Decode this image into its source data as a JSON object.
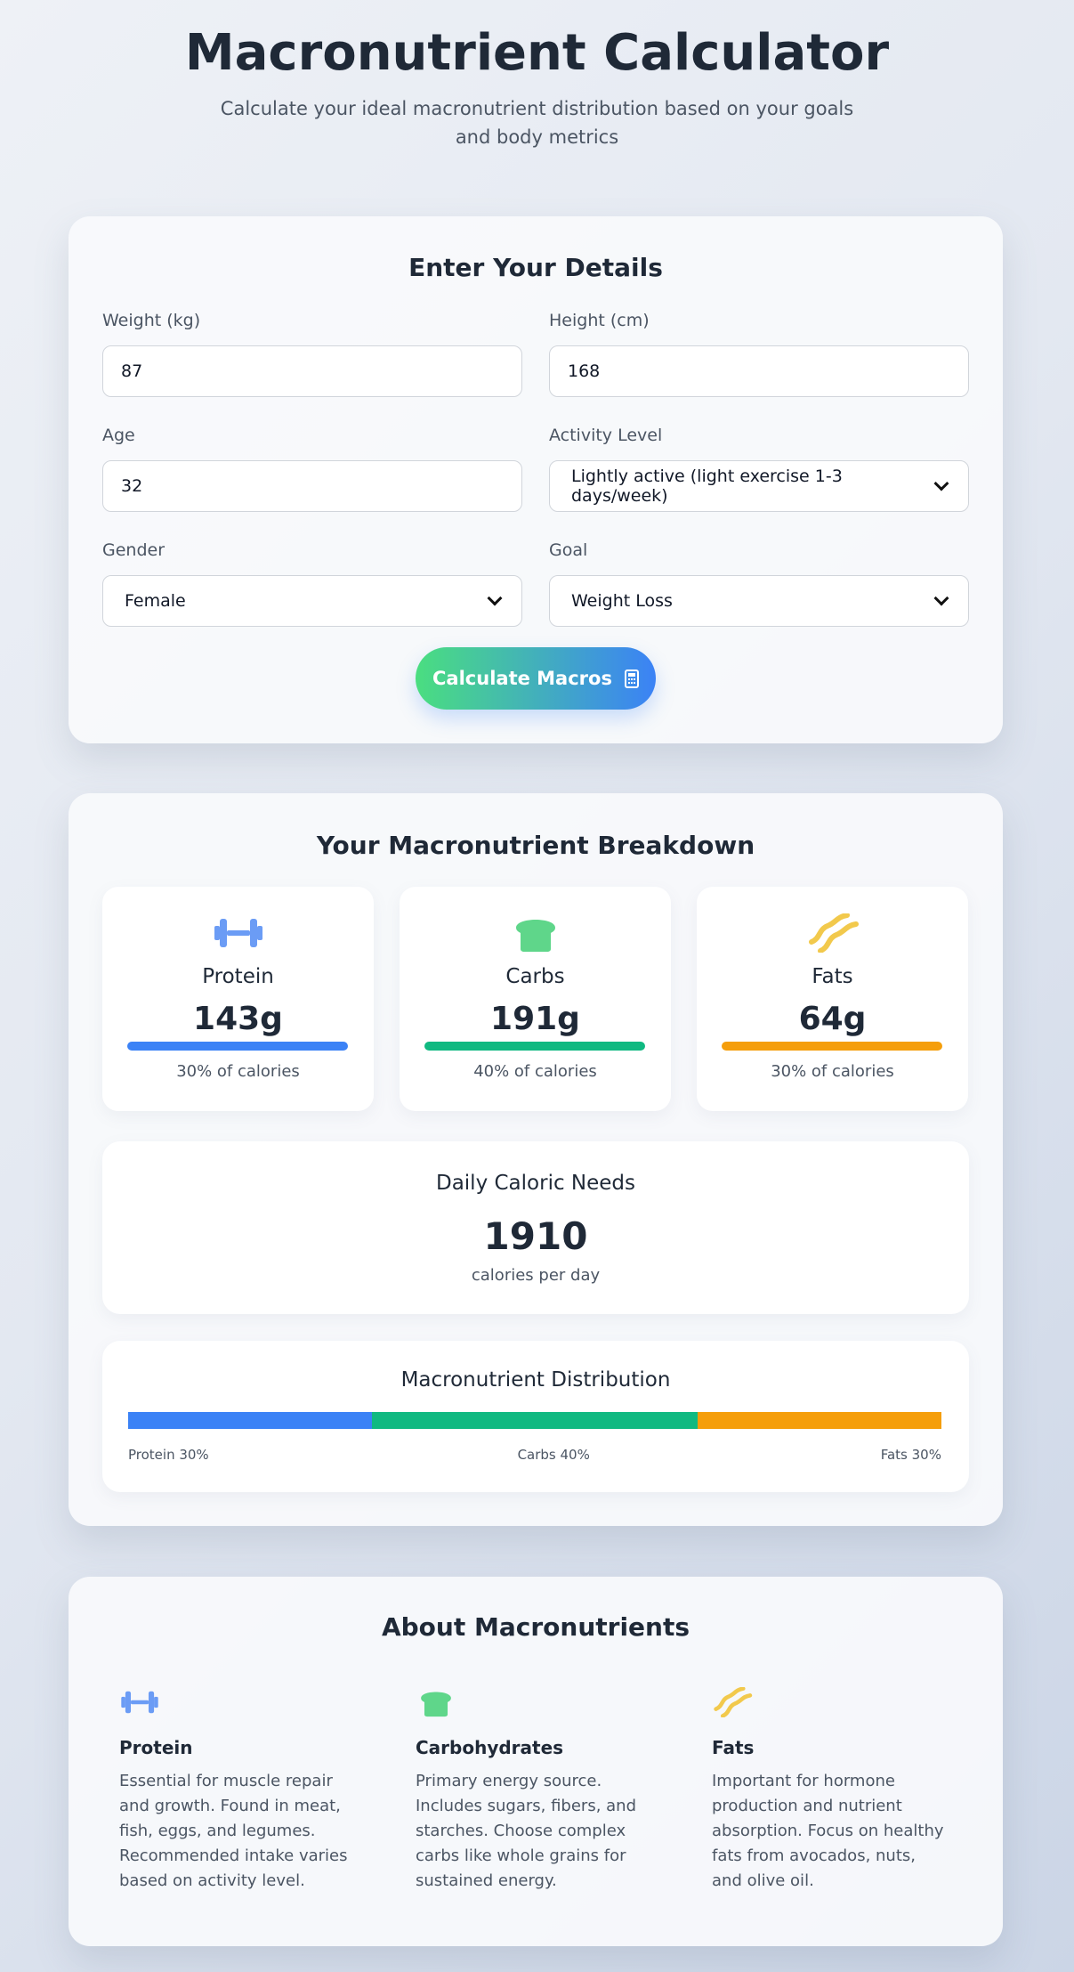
{
  "header": {
    "title": "Macronutrient Calculator",
    "subtitle": "Calculate your ideal macronutrient distribution based on your goals and body metrics"
  },
  "form": {
    "title": "Enter Your Details",
    "weight": {
      "label": "Weight (kg)",
      "value": "87"
    },
    "height": {
      "label": "Height (cm)",
      "value": "168"
    },
    "age": {
      "label": "Age",
      "value": "32"
    },
    "activity": {
      "label": "Activity Level",
      "value": "Lightly active (light exercise 1-3 days/week)"
    },
    "gender": {
      "label": "Gender",
      "value": "Female"
    },
    "goal": {
      "label": "Goal",
      "value": "Weight Loss"
    },
    "calculate_label": "Calculate Macros"
  },
  "results": {
    "title": "Your Macronutrient Breakdown",
    "macros": [
      {
        "name": "Protein",
        "grams": "143g",
        "percent_label": "30% of calories",
        "percent": 30,
        "color": "#3b82f6",
        "icon": "dumbbell-icon"
      },
      {
        "name": "Carbs",
        "grams": "191g",
        "percent_label": "40% of calories",
        "percent": 40,
        "color": "#10b981",
        "icon": "bread-icon"
      },
      {
        "name": "Fats",
        "grams": "64g",
        "percent_label": "30% of calories",
        "percent": 30,
        "color": "#f59e0b",
        "icon": "bacon-icon"
      }
    ],
    "calories": {
      "title": "Daily Caloric Needs",
      "value": "1910",
      "unit": "calories per day"
    },
    "distribution": {
      "title": "Macronutrient Distribution",
      "labels": [
        "Protein 30%",
        "Carbs 40%",
        "Fats 30%"
      ]
    }
  },
  "about": {
    "title": "About Macronutrients",
    "items": [
      {
        "name": "Protein",
        "icon": "dumbbell-icon",
        "description": "Essential for muscle repair and growth. Found in meat, fish, eggs, and legumes. Recommended intake varies based on activity level."
      },
      {
        "name": "Carbohydrates",
        "icon": "bread-icon",
        "description": "Primary energy source. Includes sugars, fibers, and starches. Choose complex carbs like whole grains for sustained energy."
      },
      {
        "name": "Fats",
        "icon": "bacon-icon",
        "description": "Important for hormone production and nutrient absorption. Focus on healthy fats from avocados, nuts, and olive oil."
      }
    ]
  },
  "colors": {
    "protein": "#3b82f6",
    "carbs": "#10b981",
    "fats": "#f59e0b",
    "button_start": "#4ade80",
    "button_end": "#3b82f6"
  }
}
